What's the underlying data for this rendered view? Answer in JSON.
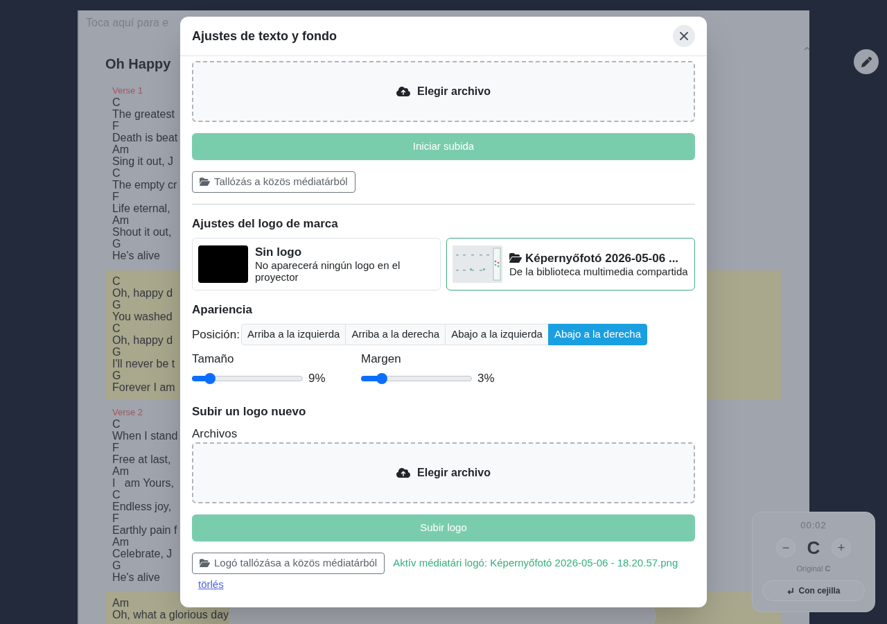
{
  "background": {
    "hint": "Toca aquí para e",
    "song_title": "Oh Happy",
    "sections": [
      {
        "kind": "verse",
        "label": "Verse 1",
        "lines": [
          {
            "chord": "C",
            "text": "The greatest"
          },
          {
            "chord": "F",
            "text": "Death is beat"
          },
          {
            "chord": "Am",
            "text": "Sing it out, J"
          },
          {
            "chord": "C",
            "text": "The empty cr"
          },
          {
            "chord": "F",
            "text": "Life eternal,"
          },
          {
            "chord": "Am",
            "text": "Shout it out,"
          },
          {
            "chord": "G",
            "text": "He's alive"
          }
        ]
      },
      {
        "kind": "chorus",
        "lines": [
          {
            "chord": "C",
            "text": "Oh, happy d"
          },
          {
            "chord": "G",
            "text": "You washed"
          },
          {
            "chord": "C",
            "text": "Oh, happy d"
          },
          {
            "chord": "G",
            "text": "I'll never be t"
          },
          {
            "chord": "G",
            "text": "Forever I am"
          }
        ]
      },
      {
        "kind": "verse",
        "label": "Verse 2",
        "lines": [
          {
            "chord": "C",
            "text": "When I stand"
          },
          {
            "chord": "F",
            "text": "Free at last,"
          },
          {
            "chord": "Am",
            "text": "I   am Yours,"
          },
          {
            "chord": "C",
            "text": "Endless joy,"
          },
          {
            "chord": "F",
            "text": "Earthly pain f"
          },
          {
            "chord": "Am",
            "text": "Celebrate, J"
          },
          {
            "chord": "G",
            "text": "He's alive"
          }
        ]
      },
      {
        "kind": "chorus",
        "lines": [
          {
            "chord": "Am",
            "text": "Oh, what a glorious day"
          }
        ]
      }
    ]
  },
  "transpose": {
    "time": "00:02",
    "decrease": "−",
    "key": "C",
    "increase": "+",
    "original": "Original **C**",
    "capo_button": "Con cejilla"
  },
  "dialog": {
    "title": "Ajustes de texto y fondo",
    "background_upload": {
      "dropzone": "Elegir archivo",
      "submit": {
        "label": "Iniciar subida",
        "disabled": true
      },
      "browse": "Tallózás a közös médiatárból"
    },
    "logo": {
      "title": "Ajustes del logo de marca",
      "options": [
        {
          "kind": "none",
          "title": "Sin logo",
          "description": "No aparecerá ningún logo en el proyector",
          "selected": false
        },
        {
          "kind": "library",
          "title": "Képernyőfotó 2026-05-06 ...",
          "description": "De la biblioteca multimedia compartida",
          "selected": true
        }
      ]
    },
    "appearance": {
      "title": "Apariencia",
      "position_label": "Posición:",
      "positions": [
        {
          "label": "Arriba a la izquierda",
          "selected": false
        },
        {
          "label": "Arriba a la derecha",
          "selected": false
        },
        {
          "label": "Abajo a la izquierda",
          "selected": false
        },
        {
          "label": "Abajo a la derecha",
          "selected": true
        }
      ],
      "sliders": [
        {
          "label": "Tamaño",
          "level": 0.125,
          "reading": "9%"
        },
        {
          "label": "Margen",
          "level": 0.15,
          "reading": "3%"
        }
      ]
    },
    "logo_upload": {
      "title": "Subir un logo nuevo",
      "files_label": "Archivos",
      "dropzone": "Elegir archivo",
      "submit": {
        "label": "Subir logo",
        "disabled": true
      },
      "browse": "Logó tallózása a közös médiatárból",
      "active_logo": "Aktív médiatári logó: Képernyőfotó 2026-05-06 - 18.20.57.png",
      "remove_link": "törlés"
    }
  }
}
